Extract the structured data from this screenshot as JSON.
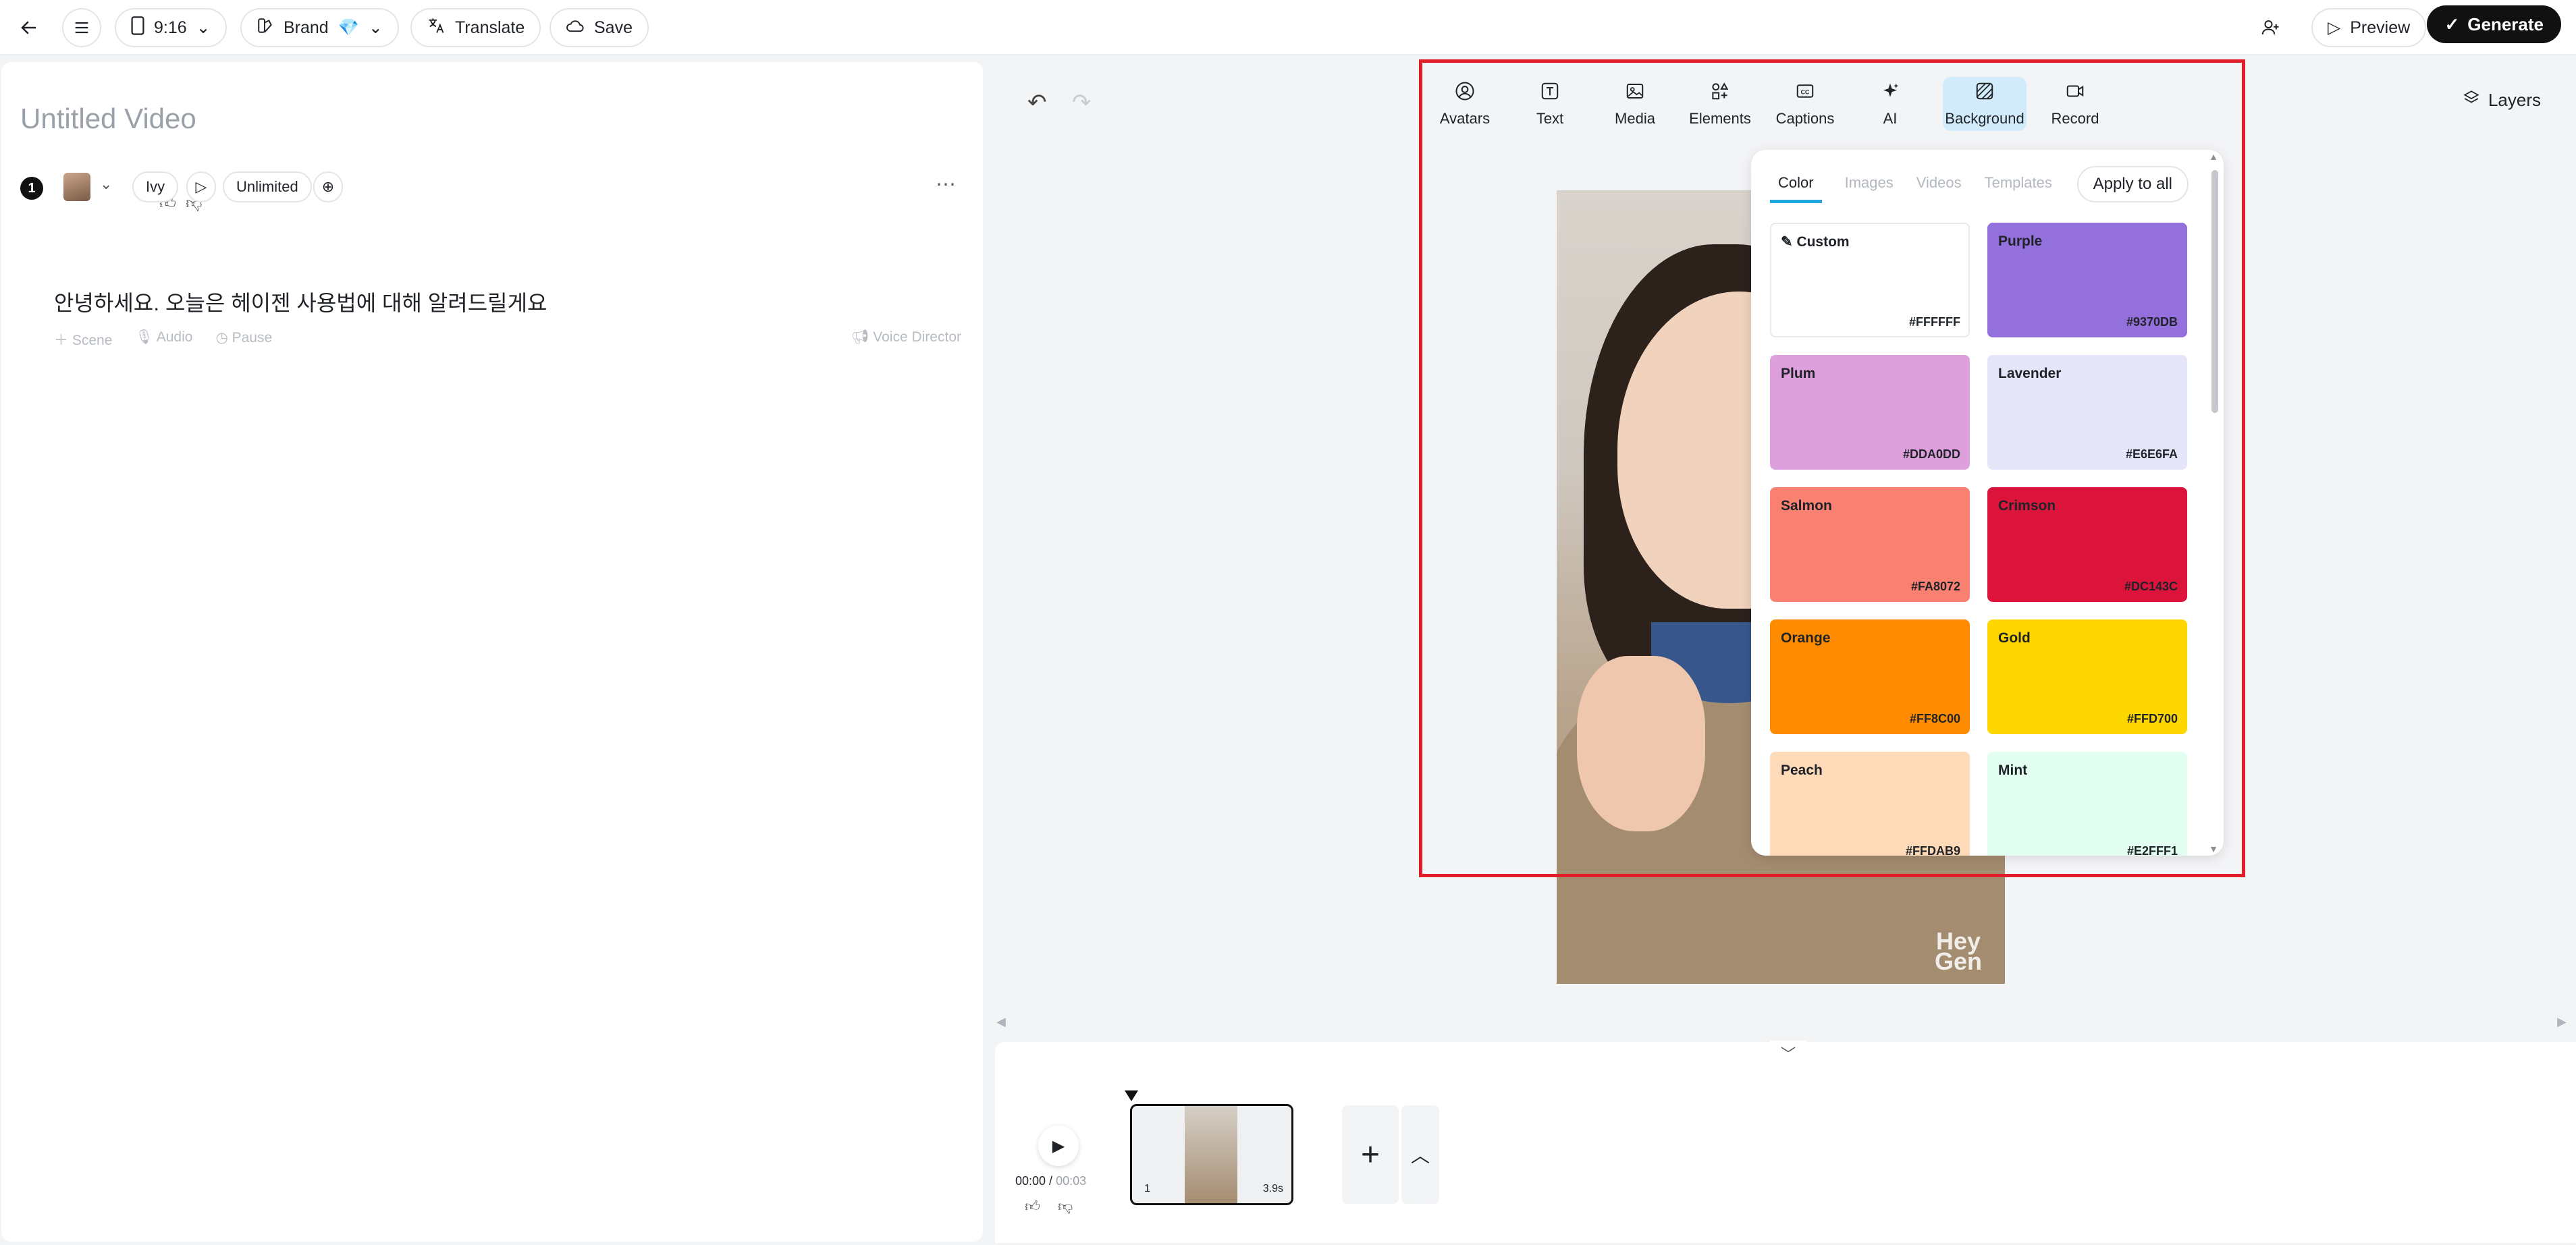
{
  "topbar": {
    "aspect_ratio": "9:16",
    "brand_label": "Brand",
    "brand_emoji": "💎",
    "translate_label": "Translate",
    "save_label": "Save",
    "preview_label": "Preview",
    "generate_label": "Generate"
  },
  "script": {
    "title": "Untitled Video",
    "scene_number": "1",
    "voice_name": "Ivy",
    "speed_label": "Unlimited",
    "text": "안녕하세요. 오늘은 헤이젠 사용법에 대해 알려드릴게요",
    "tools": [
      "Scene",
      "Audio",
      "Pause"
    ],
    "voice_director": "Voice Director"
  },
  "canvas": {
    "layers_label": "Layers",
    "watermark_line1": "Hey",
    "watermark_line2": "Gen"
  },
  "toolbar": {
    "items": [
      {
        "label": "Avatars",
        "icon": "avatar-icon"
      },
      {
        "label": "Text",
        "icon": "text-icon"
      },
      {
        "label": "Media",
        "icon": "media-icon"
      },
      {
        "label": "Elements",
        "icon": "elements-icon"
      },
      {
        "label": "Captions",
        "icon": "captions-icon"
      },
      {
        "label": "AI",
        "icon": "ai-sparkle-icon"
      },
      {
        "label": "Background",
        "icon": "background-icon"
      },
      {
        "label": "Record",
        "icon": "record-icon"
      }
    ],
    "active": "Background"
  },
  "background_panel": {
    "tabs": [
      "Color",
      "Images",
      "Videos",
      "Templates"
    ],
    "active_tab": "Color",
    "apply_label": "Apply to all",
    "swatches": [
      {
        "name": "Custom",
        "hex": "#FFFFFF"
      },
      {
        "name": "Purple",
        "hex": "#9370DB"
      },
      {
        "name": "Plum",
        "hex": "#DDA0DD"
      },
      {
        "name": "Lavender",
        "hex": "#E6E6FA"
      },
      {
        "name": "Salmon",
        "hex": "#FA8072"
      },
      {
        "name": "Crimson",
        "hex": "#DC143C"
      },
      {
        "name": "Orange",
        "hex": "#FF8C00"
      },
      {
        "name": "Gold",
        "hex": "#FFD700"
      },
      {
        "name": "Peach",
        "hex": "#FFDAB9"
      },
      {
        "name": "Mint",
        "hex": "#E2FFF1"
      }
    ]
  },
  "timeline": {
    "current_time": "00:00",
    "duration": "00:03",
    "clip_number": "1",
    "clip_duration": "3.9s"
  },
  "colors": {
    "accent": "#1FA5E0",
    "highlight_border": "#E11D2A",
    "generate_bg": "#111111"
  }
}
